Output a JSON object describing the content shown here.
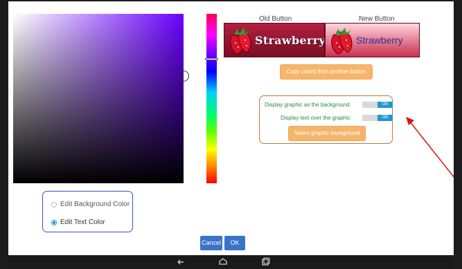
{
  "picker": {
    "radio_background": "Edit Background Color",
    "radio_text": "Edit Text Color",
    "selected": "text"
  },
  "preview": {
    "old_label": "Old Button",
    "new_label": "New Button",
    "old_button_text": "Strawberry",
    "new_button_text": "Strawberry"
  },
  "actions": {
    "copy_colors": "Copy colors from another button",
    "select_graphic": "Select graphic background"
  },
  "graphic": {
    "display_background_label": "Display graphic as the background",
    "display_background_state": "ON",
    "display_text_label": "Display text over the graphic",
    "display_text_state": "ON"
  },
  "dialog": {
    "cancel": "Cancel",
    "ok": "OK"
  },
  "colors": {
    "accent_blue": "#3a74c8",
    "orange": "#f5b56b",
    "box_border": "#c0763a",
    "arrow": "#e01010"
  },
  "nav_icons": [
    "back-icon",
    "home-icon",
    "recents-icon"
  ]
}
